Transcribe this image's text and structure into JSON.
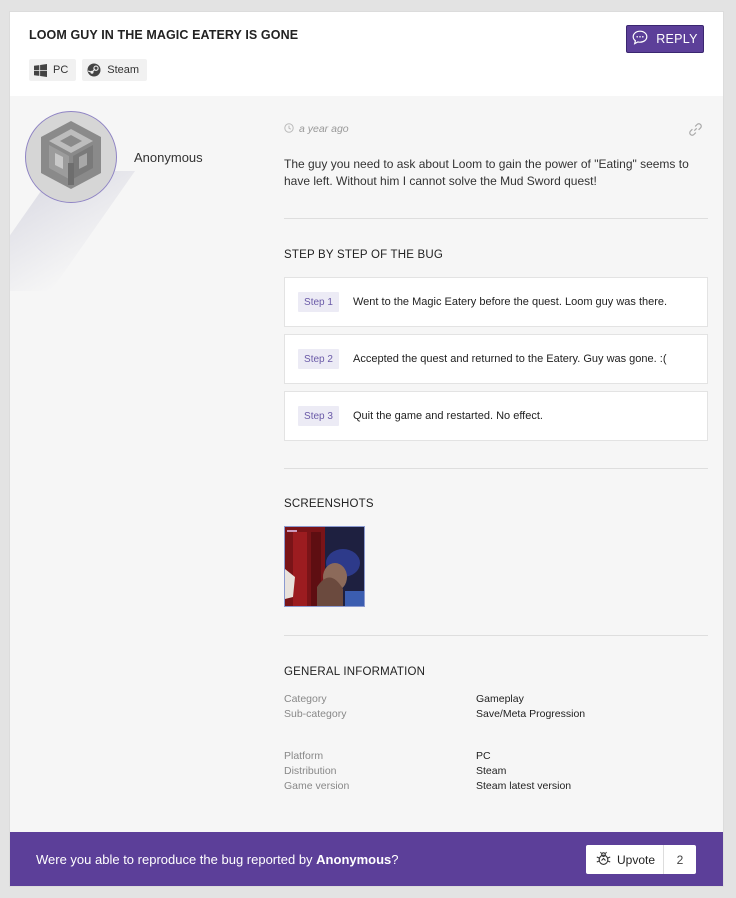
{
  "header": {
    "title": "LOOM GUY IN THE MAGIC EATERY IS GONE",
    "tags": [
      {
        "label": "PC",
        "icon": "windows-icon"
      },
      {
        "label": "Steam",
        "icon": "steam-icon"
      }
    ],
    "reply_label": "REPLY"
  },
  "author": {
    "name": "Anonymous",
    "avatar_icon": "default-avatar-cube-icon"
  },
  "post": {
    "time": "a year ago",
    "description": "The guy you need to ask about Loom to gain the power of \"Eating\" seems to have left. Without him I cannot solve the Mud Sword quest!"
  },
  "steps_section": {
    "title": "STEP BY STEP OF THE BUG",
    "steps": [
      {
        "badge": "Step 1",
        "text": "Went to the Magic Eatery before the quest. Loom guy was there."
      },
      {
        "badge": "Step 2",
        "text": "Accepted the quest and returned to the Eatery. Guy was gone. :("
      },
      {
        "badge": "Step 3",
        "text": "Quit the game and restarted. No effect."
      }
    ]
  },
  "screenshots_section": {
    "title": "SCREENSHOTS"
  },
  "general_info": {
    "title": "GENERAL INFORMATION",
    "group1": [
      {
        "key": "Category",
        "value": "Gameplay"
      },
      {
        "key": "Sub-category",
        "value": "Save/Meta Progression"
      }
    ],
    "group2": [
      {
        "key": "Platform",
        "value": "PC"
      },
      {
        "key": "Distribution",
        "value": "Steam"
      },
      {
        "key": "Game version",
        "value": "Steam latest version"
      }
    ]
  },
  "footer": {
    "prompt_prefix": "Were you able to reproduce the bug reported by ",
    "prompt_author": "Anonymous",
    "prompt_suffix": "?",
    "upvote_label": "Upvote",
    "upvote_count": "2"
  },
  "colors": {
    "accent": "#5c3f99",
    "step_badge_bg": "#ecebf5",
    "page_bg": "#f6f6f6"
  }
}
